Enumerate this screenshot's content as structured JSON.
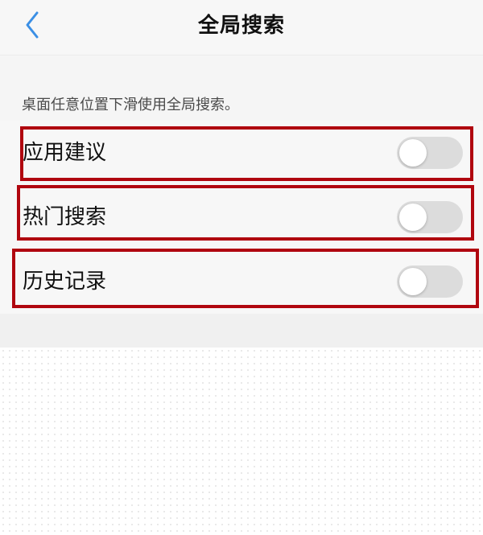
{
  "header": {
    "title": "全局搜索"
  },
  "description": "桌面任意位置下滑使用全局搜索。",
  "settings": [
    {
      "label": "应用建议",
      "enabled": false
    },
    {
      "label": "热门搜索",
      "enabled": false
    },
    {
      "label": "历史记录",
      "enabled": false
    }
  ],
  "colors": {
    "accent": "#3b8fe5",
    "highlight_box": "#b0060f",
    "toggle_off": "#dcdcdc"
  }
}
